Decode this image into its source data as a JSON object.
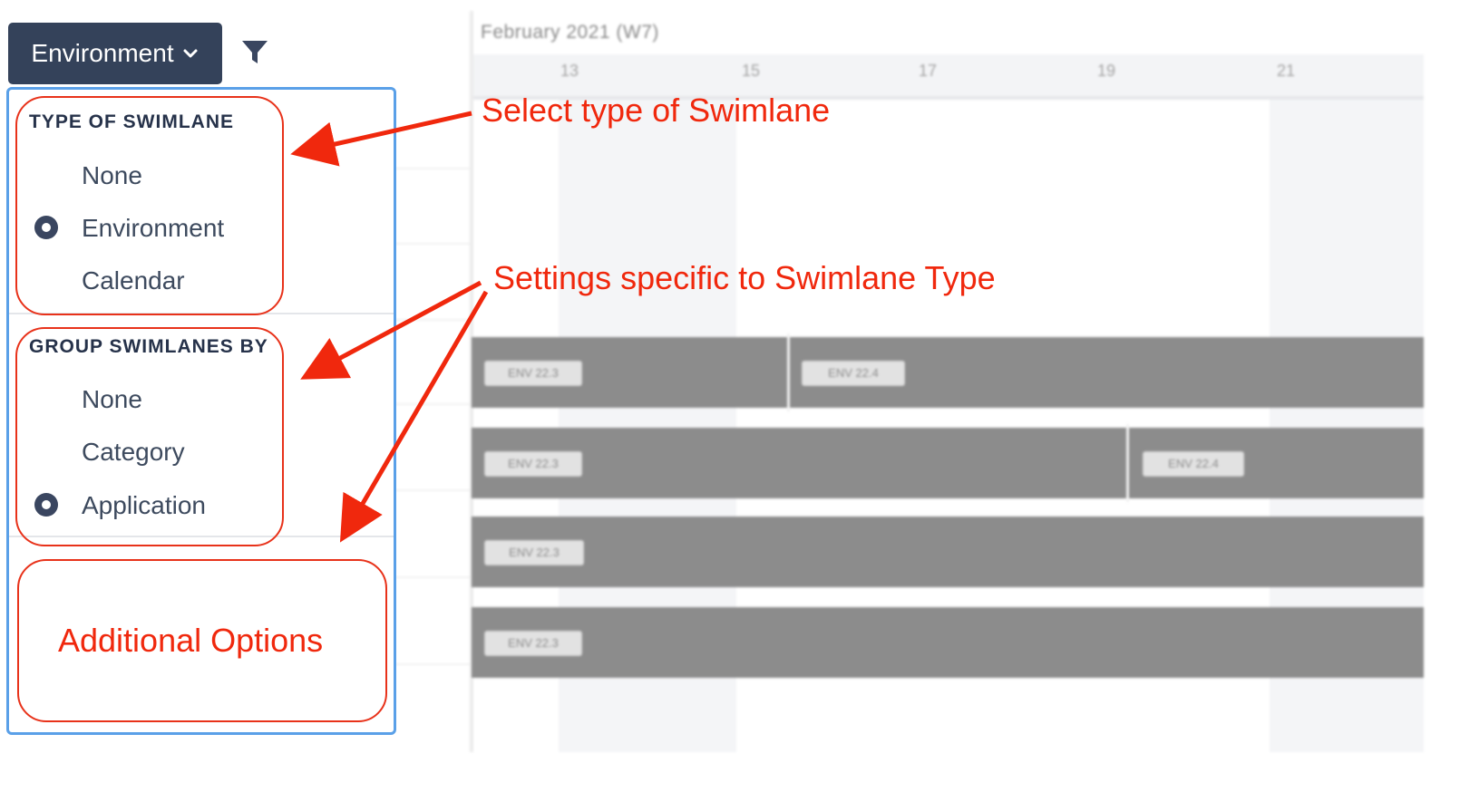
{
  "toolbar": {
    "swimlane_button_label": "Environment",
    "filter_icon": "filter-icon"
  },
  "timeline": {
    "month_label": "February 2021 (W7)",
    "days": [
      "13",
      "15",
      "17",
      "19",
      "21"
    ],
    "lane_tags": [
      "ENV 22.3",
      "ENV 22.4",
      "ENV 22.3",
      "ENV 22.4",
      "ENV 22.3",
      "ENV 22.3"
    ]
  },
  "panel": {
    "type_section": {
      "heading": "TYPE OF SWIMLANE",
      "options": [
        "None",
        "Environment",
        "Calendar"
      ],
      "selected": "Environment"
    },
    "group_section": {
      "heading": "GROUP SWIMLANES BY",
      "options": [
        "None",
        "Category",
        "Application"
      ],
      "selected": "Application"
    }
  },
  "annotations": {
    "select_type": "Select type of Swimlane",
    "settings_specific": "Settings specific to Swimlane Type",
    "additional_options": "Additional Options"
  },
  "colors": {
    "button_bg": "#34425a",
    "panel_border": "#5aa0e8",
    "annotation_red": "#f0280d",
    "lane_gray": "#8c8c8c"
  }
}
